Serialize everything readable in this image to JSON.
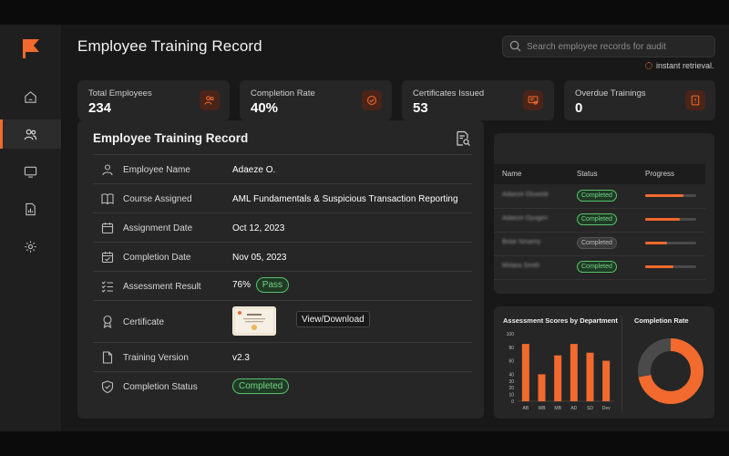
{
  "header": {
    "title": "Employee Training Record",
    "search_placeholder": "Search employee records for audit",
    "retrieval_note": "instant retrieval."
  },
  "sidebar": {
    "items": [
      {
        "icon": "home-icon",
        "active": false
      },
      {
        "icon": "users-icon",
        "active": true
      },
      {
        "icon": "monitor-icon",
        "active": false
      },
      {
        "icon": "report-icon",
        "active": false
      },
      {
        "icon": "gear-icon",
        "active": false
      }
    ]
  },
  "stats": [
    {
      "label": "Total Employees",
      "value": "234",
      "icon": "users-icon"
    },
    {
      "label": "Completion Rate",
      "value": "40%",
      "icon": "check-circle-icon"
    },
    {
      "label": "Certificates Issued",
      "value": "53",
      "icon": "certificate-icon"
    },
    {
      "label": "Overdue Trainings",
      "value": "0",
      "icon": "alert-icon"
    }
  ],
  "record": {
    "title": "Employee Training Record",
    "fields": {
      "employee_name": {
        "label": "Employee Name",
        "value": "Adaeze O."
      },
      "course": {
        "label": "Course Assigned",
        "value": "AML Fundamentals & Suspicious Transaction Reporting"
      },
      "assignment_date": {
        "label": "Assignment Date",
        "value": "Oct 12, 2023"
      },
      "completion_date": {
        "label": "Completion Date",
        "value": "Nov 05, 2023"
      },
      "assessment": {
        "label": "Assessment Result",
        "value": "76%",
        "badge": "Pass"
      },
      "certificate": {
        "label": "Certificate",
        "action": "View/Download"
      },
      "version": {
        "label": "Training Version",
        "value": "v2.3"
      },
      "status": {
        "label": "Completion Status",
        "value": "Completed"
      }
    }
  },
  "table": {
    "columns": [
      "Name",
      "Status",
      "Progress"
    ],
    "rows": [
      {
        "name": "Adaeze Oluwole",
        "status": "Completed",
        "status_color": "green",
        "progress": 0.75
      },
      {
        "name": "Adaeze Oyugen",
        "status": "Completed",
        "status_color": "green",
        "progress": 0.68
      },
      {
        "name": "Bolar Nmamy",
        "status": "Completed",
        "status_color": "gray",
        "progress": 0.42
      },
      {
        "name": "Molara Smith",
        "status": "Completed",
        "status_color": "green",
        "progress": 0.55
      }
    ]
  },
  "chart_data": [
    {
      "type": "bar",
      "title": "Assessment Scores by Department",
      "categories": [
        "AB",
        "WB",
        "MB",
        "AD",
        "SD",
        "Dev"
      ],
      "values": [
        85,
        40,
        68,
        85,
        72,
        60
      ],
      "ylim": [
        0,
        100
      ],
      "yticks": [
        0,
        10,
        20,
        30,
        40,
        60,
        80,
        100
      ],
      "color": "#f26a2e"
    },
    {
      "type": "pie",
      "title": "Completion Rate",
      "donut": true,
      "slices": [
        {
          "value": 0.72,
          "color": "#f26a2e"
        },
        {
          "value": 0.28,
          "color": "#4a4a4a"
        }
      ]
    }
  ],
  "colors": {
    "accent": "#f26a2e",
    "success": "#57c26c"
  }
}
